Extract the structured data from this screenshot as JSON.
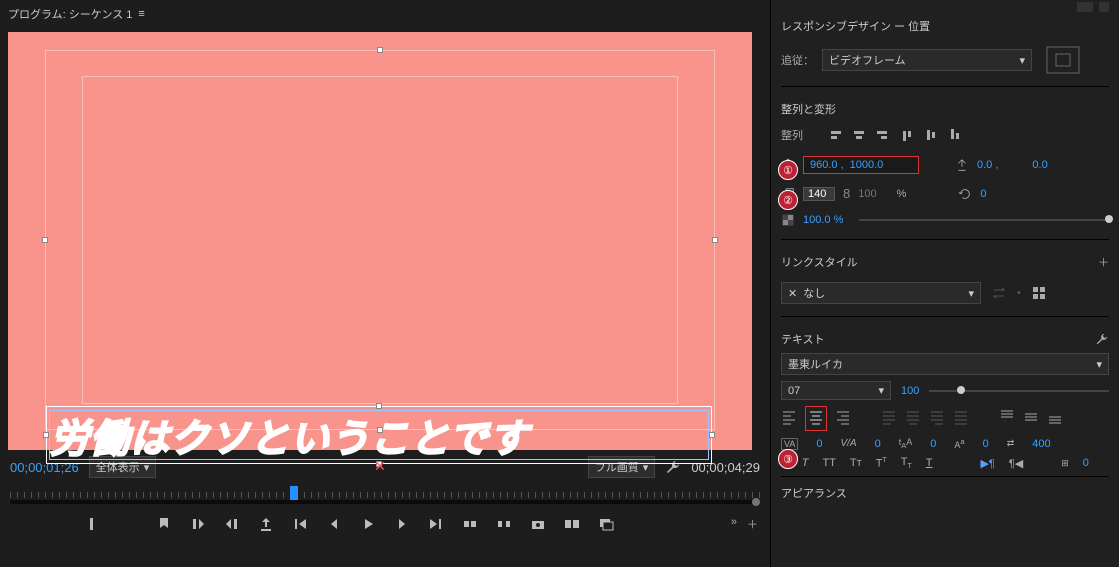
{
  "program": {
    "label": "プログラム: シーケンス 1"
  },
  "preview": {
    "subtitle": "労働はクソということです"
  },
  "time": {
    "current": "00;00;01;26",
    "duration": "00;00;04;29",
    "display_mode": "全体表示",
    "quality": "フル画質"
  },
  "right": {
    "responsive": {
      "title": "レスポンシブデザイン ー 位置",
      "follow_label": "追従：",
      "follow_value": "ビデオフレーム"
    },
    "align_section": {
      "title": "整列と変形",
      "align_label": "整列"
    },
    "position": {
      "x": "960.0 ,",
      "y": "1000.0",
      "anchor_x": "0.0 ,",
      "anchor_y": "0.0"
    },
    "scale": {
      "value": "140",
      "locked_value": "100",
      "unit": "%",
      "rotation": "0"
    },
    "opacity": {
      "value": "100.0 %"
    },
    "link_style": {
      "title": "リンクスタイル",
      "value": "なし"
    },
    "text": {
      "title": "テキスト",
      "font": "墨東ルイカ",
      "weight": "07",
      "size": "100",
      "tracking": "0",
      "kerning": "0",
      "tsume": "0",
      "scale_v": "0",
      "leading": "400"
    },
    "appearance": {
      "title": "アピアランス"
    }
  },
  "badges": {
    "b1": "①",
    "b2": "②",
    "b3": "③"
  }
}
